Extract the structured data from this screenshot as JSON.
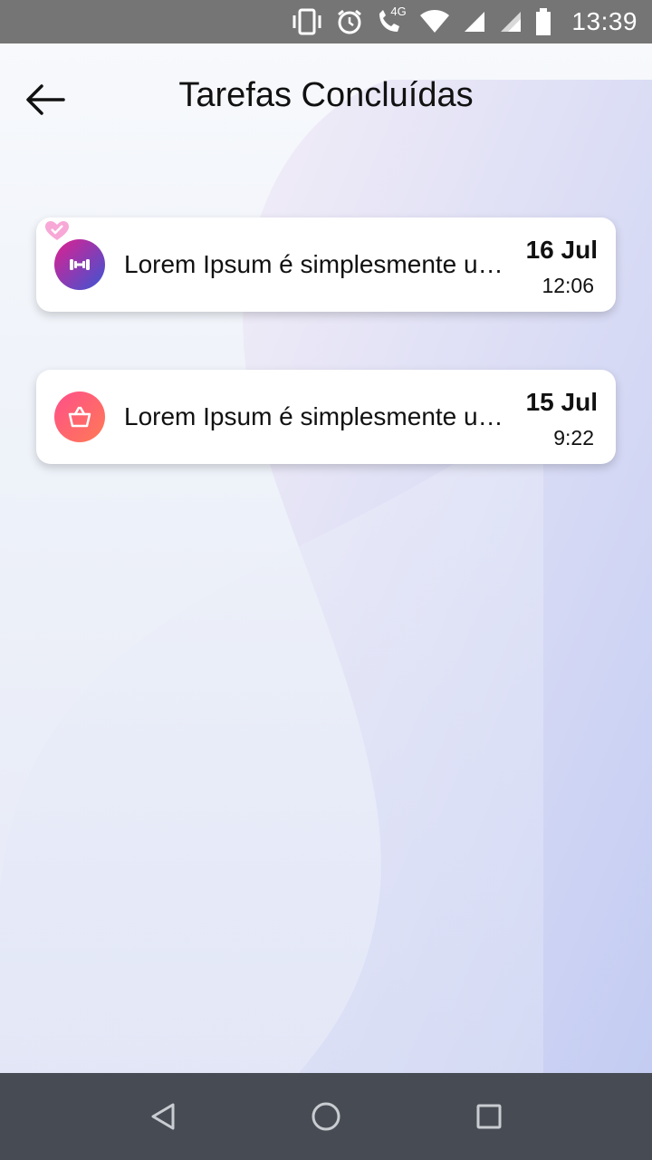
{
  "status_bar": {
    "time": "13:39",
    "network_label": "4G",
    "icons": [
      "vibrate-icon",
      "alarm-icon",
      "volte-call-icon",
      "wifi-icon",
      "signal-icon",
      "signal-icon",
      "battery-icon"
    ]
  },
  "header": {
    "title": "Tarefas Concluídas",
    "back_icon": "arrow-left-icon"
  },
  "tasks": [
    {
      "icon": "dumbbell-icon",
      "icon_gradient": [
        "#e0208f",
        "#3b55d4"
      ],
      "badge_icon": "heart-check-icon",
      "text": "Lorem Ipsum é simplesmente uma simulação de texto",
      "date": "16 Jul",
      "time": "12:06"
    },
    {
      "icon": "basket-icon",
      "icon_gradient": [
        "#ff4f8a",
        "#ff7a55"
      ],
      "text": "Lorem Ipsum é simplesmente uma simulação de texto",
      "date": "15 Jul",
      "time": "9:22"
    }
  ],
  "nav_bar": {
    "buttons": [
      "back-triangle-icon",
      "home-circle-icon",
      "recents-square-icon"
    ]
  },
  "colors": {
    "status_bar": "#757575",
    "nav_bar": "#474c54",
    "card": "#ffffff",
    "text": "#111111"
  }
}
